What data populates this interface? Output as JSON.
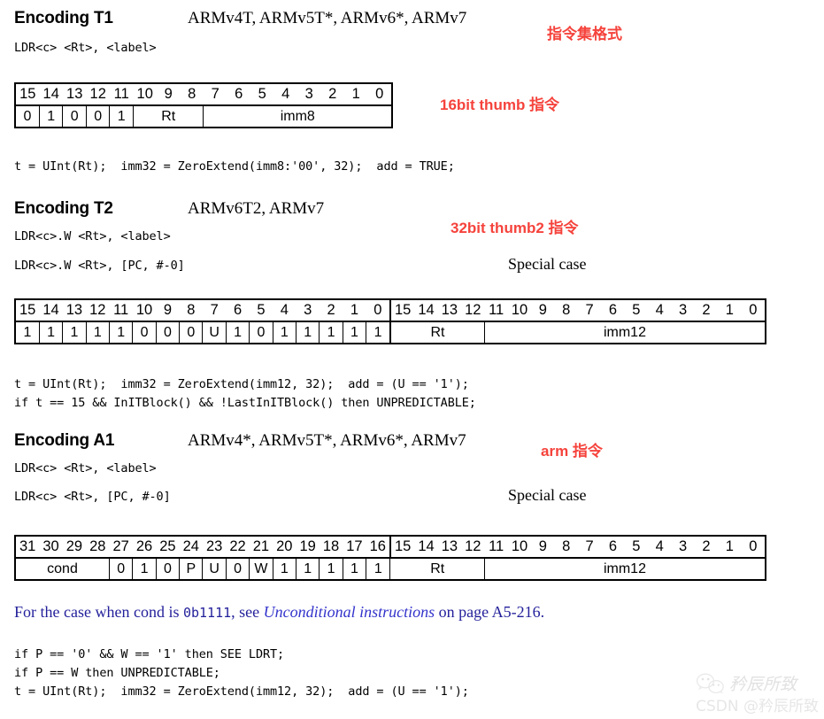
{
  "encodings": [
    {
      "title": "Encoding T1",
      "arch": "ARMv4T, ARMv5T*, ARMv6*, ARMv7",
      "syntax": [
        "LDR<c> <Rt>, <label>"
      ],
      "special_case": null,
      "annotation": "16bit thumb 指令",
      "pseudocode": "t = UInt(Rt);  imm32 = ZeroExtend(imm8:'00', 32);  add = TRUE;"
    },
    {
      "title": "Encoding T2",
      "arch": "ARMv6T2, ARMv7",
      "syntax": [
        "LDR<c>.W <Rt>, <label>",
        "LDR<c>.W <Rt>, [PC, #-0]"
      ],
      "special_case": "Special case",
      "annotation": "32bit thumb2 指令",
      "pseudocode": "t = UInt(Rt);  imm32 = ZeroExtend(imm12, 32);  add = (U == '1');\nif t == 15 && InITBlock() && !LastInITBlock() then UNPREDICTABLE;"
    },
    {
      "title": "Encoding A1",
      "arch": "ARMv4*, ARMv5T*, ARMv6*, ARMv7",
      "syntax": [
        "LDR<c> <Rt>, <label>",
        "LDR<c> <Rt>, [PC, #-0]"
      ],
      "special_case": "Special case",
      "annotation": "arm 指令",
      "pseudocode": "if P == '0' && W == '1' then SEE LDRT;\nif P == W then UNPREDICTABLE;\nt = UInt(Rt);  imm32 = ZeroExtend(imm12, 32);  add = (U == '1');"
    }
  ],
  "top_annotation": "指令集格式",
  "tables": {
    "t1": {
      "bits": [
        "15",
        "14",
        "13",
        "12",
        "11",
        "10",
        "9",
        "8",
        "7",
        "6",
        "5",
        "4",
        "3",
        "2",
        "1",
        "0"
      ],
      "fields": [
        {
          "label": "0",
          "span": 1
        },
        {
          "label": "1",
          "span": 1
        },
        {
          "label": "0",
          "span": 1
        },
        {
          "label": "0",
          "span": 1
        },
        {
          "label": "1",
          "span": 1
        },
        {
          "label": "Rt",
          "span": 3
        },
        {
          "label": "imm8",
          "span": 8
        }
      ]
    },
    "t2": {
      "bits": [
        "15",
        "14",
        "13",
        "12",
        "11",
        "10",
        "9",
        "8",
        "7",
        "6",
        "5",
        "4",
        "3",
        "2",
        "1",
        "0",
        "15",
        "14",
        "13",
        "12",
        "11",
        "10",
        "9",
        "8",
        "7",
        "6",
        "5",
        "4",
        "3",
        "2",
        "1",
        "0"
      ],
      "fields": [
        {
          "label": "1",
          "span": 1
        },
        {
          "label": "1",
          "span": 1
        },
        {
          "label": "1",
          "span": 1
        },
        {
          "label": "1",
          "span": 1
        },
        {
          "label": "1",
          "span": 1
        },
        {
          "label": "0",
          "span": 1
        },
        {
          "label": "0",
          "span": 1
        },
        {
          "label": "0",
          "span": 1
        },
        {
          "label": "U",
          "span": 1
        },
        {
          "label": "1",
          "span": 1
        },
        {
          "label": "0",
          "span": 1
        },
        {
          "label": "1",
          "span": 1
        },
        {
          "label": "1",
          "span": 1
        },
        {
          "label": "1",
          "span": 1
        },
        {
          "label": "1",
          "span": 1
        },
        {
          "label": "1",
          "span": 1
        },
        {
          "label": "Rt",
          "span": 4,
          "split": true
        },
        {
          "label": "imm12",
          "span": 12
        }
      ]
    },
    "a1": {
      "bits": [
        "31",
        "30",
        "29",
        "28",
        "27",
        "26",
        "25",
        "24",
        "23",
        "22",
        "21",
        "20",
        "19",
        "18",
        "17",
        "16",
        "15",
        "14",
        "13",
        "12",
        "11",
        "10",
        "9",
        "8",
        "7",
        "6",
        "5",
        "4",
        "3",
        "2",
        "1",
        "0"
      ],
      "fields": [
        {
          "label": "cond",
          "span": 4
        },
        {
          "label": "0",
          "span": 1
        },
        {
          "label": "1",
          "span": 1
        },
        {
          "label": "0",
          "span": 1
        },
        {
          "label": "P",
          "span": 1
        },
        {
          "label": "U",
          "span": 1
        },
        {
          "label": "0",
          "span": 1
        },
        {
          "label": "W",
          "span": 1
        },
        {
          "label": "1",
          "span": 1
        },
        {
          "label": "1",
          "span": 1
        },
        {
          "label": "1",
          "span": 1
        },
        {
          "label": "1",
          "span": 1
        },
        {
          "label": "1",
          "span": 1
        },
        {
          "label": "Rt",
          "span": 4
        },
        {
          "label": "imm12",
          "span": 12
        }
      ]
    }
  },
  "footnote": {
    "prefix": "For the case when cond is ",
    "code": "0b1111",
    "middle": ", see ",
    "link": "Unconditional instructions",
    "suffix": " on page A5-216."
  },
  "watermark": {
    "name": "矜辰所致",
    "handle": "CSDN @矜辰所致"
  }
}
